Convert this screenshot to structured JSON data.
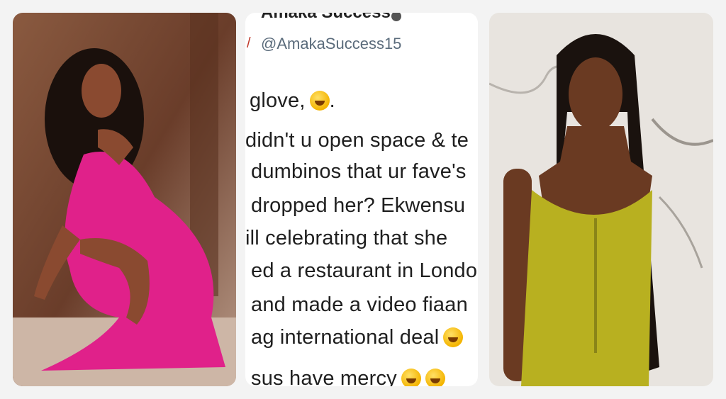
{
  "tweet": {
    "display_name": "Amaka Success",
    "handle": "@AmakaSuccess15",
    "lines": [
      {
        "text": "glove,",
        "emoji": 1,
        "suffix": "."
      },
      {
        "text": "didn't u open space & te",
        "emoji": 0,
        "suffix": ""
      },
      {
        "text": "dumbinos that ur fave's",
        "emoji": 0,
        "suffix": ""
      },
      {
        "text": "dropped her? Ekwensu",
        "emoji": 0,
        "suffix": ""
      },
      {
        "text": "ill celebrating that she",
        "emoji": 0,
        "suffix": ""
      },
      {
        "text": "ed a restaurant in Londo",
        "emoji": 0,
        "suffix": ""
      },
      {
        "text": "and made a video fiaan",
        "emoji": 0,
        "suffix": ""
      },
      {
        "text": "ag international deal",
        "emoji": 1,
        "suffix": ""
      },
      {
        "text": "sus have mercy",
        "emoji": 2,
        "suffix": ""
      }
    ],
    "emoji_name": "rolling-on-floor-laughing-emoji"
  },
  "photos": {
    "left": {
      "icon": "woman-pink-dress-photo",
      "dress_color": "#e0218a",
      "background_color": "#7a4a35"
    },
    "right": {
      "icon": "woman-yellow-dress-photo",
      "dress_color": "#b8b020",
      "background_color": "#e8e4df"
    }
  }
}
